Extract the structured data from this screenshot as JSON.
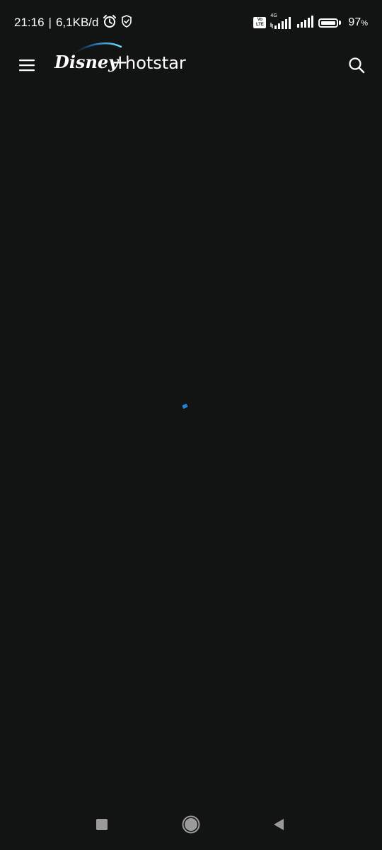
{
  "status_bar": {
    "time": "21:16",
    "separator": "|",
    "data_usage": "6,1KB/d",
    "network_type": "4G",
    "volte_top": "Vo",
    "volte_bottom": "LTE",
    "battery_percent": "97",
    "battery_unit": "%",
    "battery_level": 0.97
  },
  "app_header": {
    "brand_logo": "Disney+ hotstar",
    "menu_icon": "hamburger-menu-icon",
    "search_icon": "search-icon"
  },
  "loading": {
    "accent_color": "#1f80e0"
  },
  "nav_bar": {
    "recents_icon": "square-recents-icon",
    "home_icon": "circle-home-icon",
    "back_icon": "triangle-back-icon"
  },
  "colors": {
    "background": "#121414",
    "foreground": "#ffffff",
    "accent": "#1f80e0"
  }
}
